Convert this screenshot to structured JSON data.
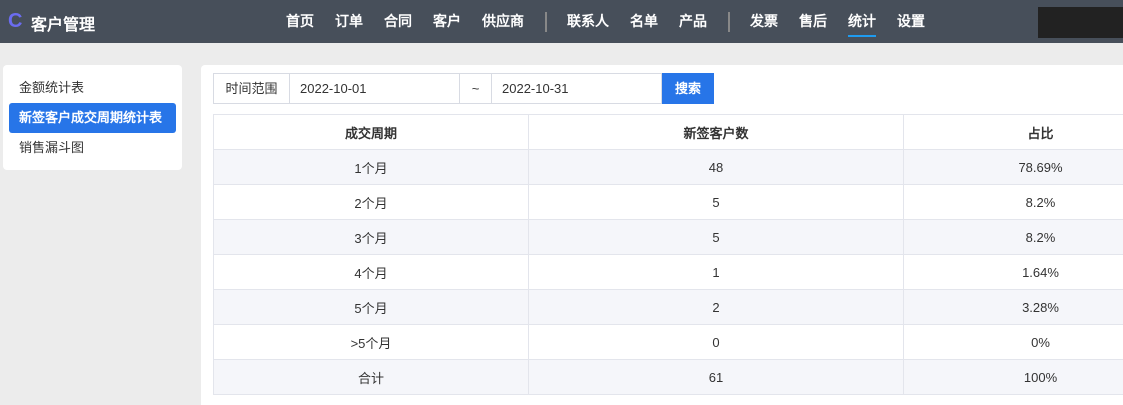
{
  "header": {
    "logo": "C",
    "title": "客户管理",
    "nav": [
      [
        "首页",
        "订单",
        "合同",
        "客户",
        "供应商"
      ],
      [
        "联系人",
        "名单",
        "产品"
      ],
      [
        "发票",
        "售后",
        "统计",
        "设置"
      ]
    ],
    "active": "统计"
  },
  "sidebar": {
    "items": [
      "金额统计表",
      "新签客户成交周期统计表",
      "销售漏斗图"
    ],
    "active_index": 1
  },
  "search": {
    "label": "时间范围",
    "start": "2022-10-01",
    "separator": "~",
    "end": "2022-10-31",
    "button": "搜索"
  },
  "table": {
    "headers": [
      "成交周期",
      "新签客户数",
      "占比"
    ],
    "rows": [
      [
        "1个月",
        "48",
        "78.69%"
      ],
      [
        "2个月",
        "5",
        "8.2%"
      ],
      [
        "3个月",
        "5",
        "8.2%"
      ],
      [
        "4个月",
        "1",
        "1.64%"
      ],
      [
        "5个月",
        "2",
        "3.28%"
      ],
      [
        ">5个月",
        "0",
        "0%"
      ],
      [
        "合计",
        "61",
        "100%"
      ]
    ]
  }
}
